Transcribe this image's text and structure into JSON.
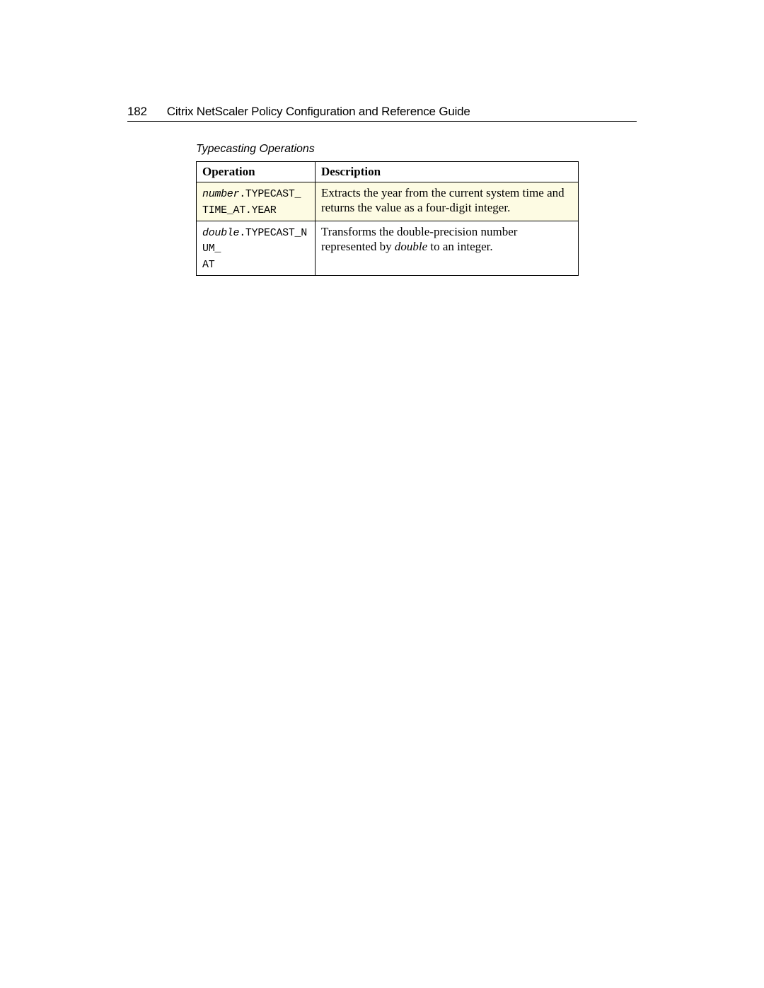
{
  "header": {
    "pageNumber": "182",
    "title": "Citrix NetScaler Policy Configuration and Reference Guide"
  },
  "table": {
    "caption": "Typecasting Operations",
    "headers": {
      "operation": "Operation",
      "description": "Description"
    },
    "rows": [
      {
        "op_var": "number",
        "op_rest1": ".TYPECAST_",
        "op_rest2": "TIME_AT.YEAR",
        "desc": "Extracts the year from the current system time and returns the value as a four-digit integer."
      },
      {
        "op_var": "double",
        "op_rest1": ".TYPECAST_NUM_",
        "op_rest2": "AT",
        "desc_pre": "Transforms the double-precision number represented by ",
        "desc_em": "double",
        "desc_post": " to an integer."
      }
    ]
  }
}
